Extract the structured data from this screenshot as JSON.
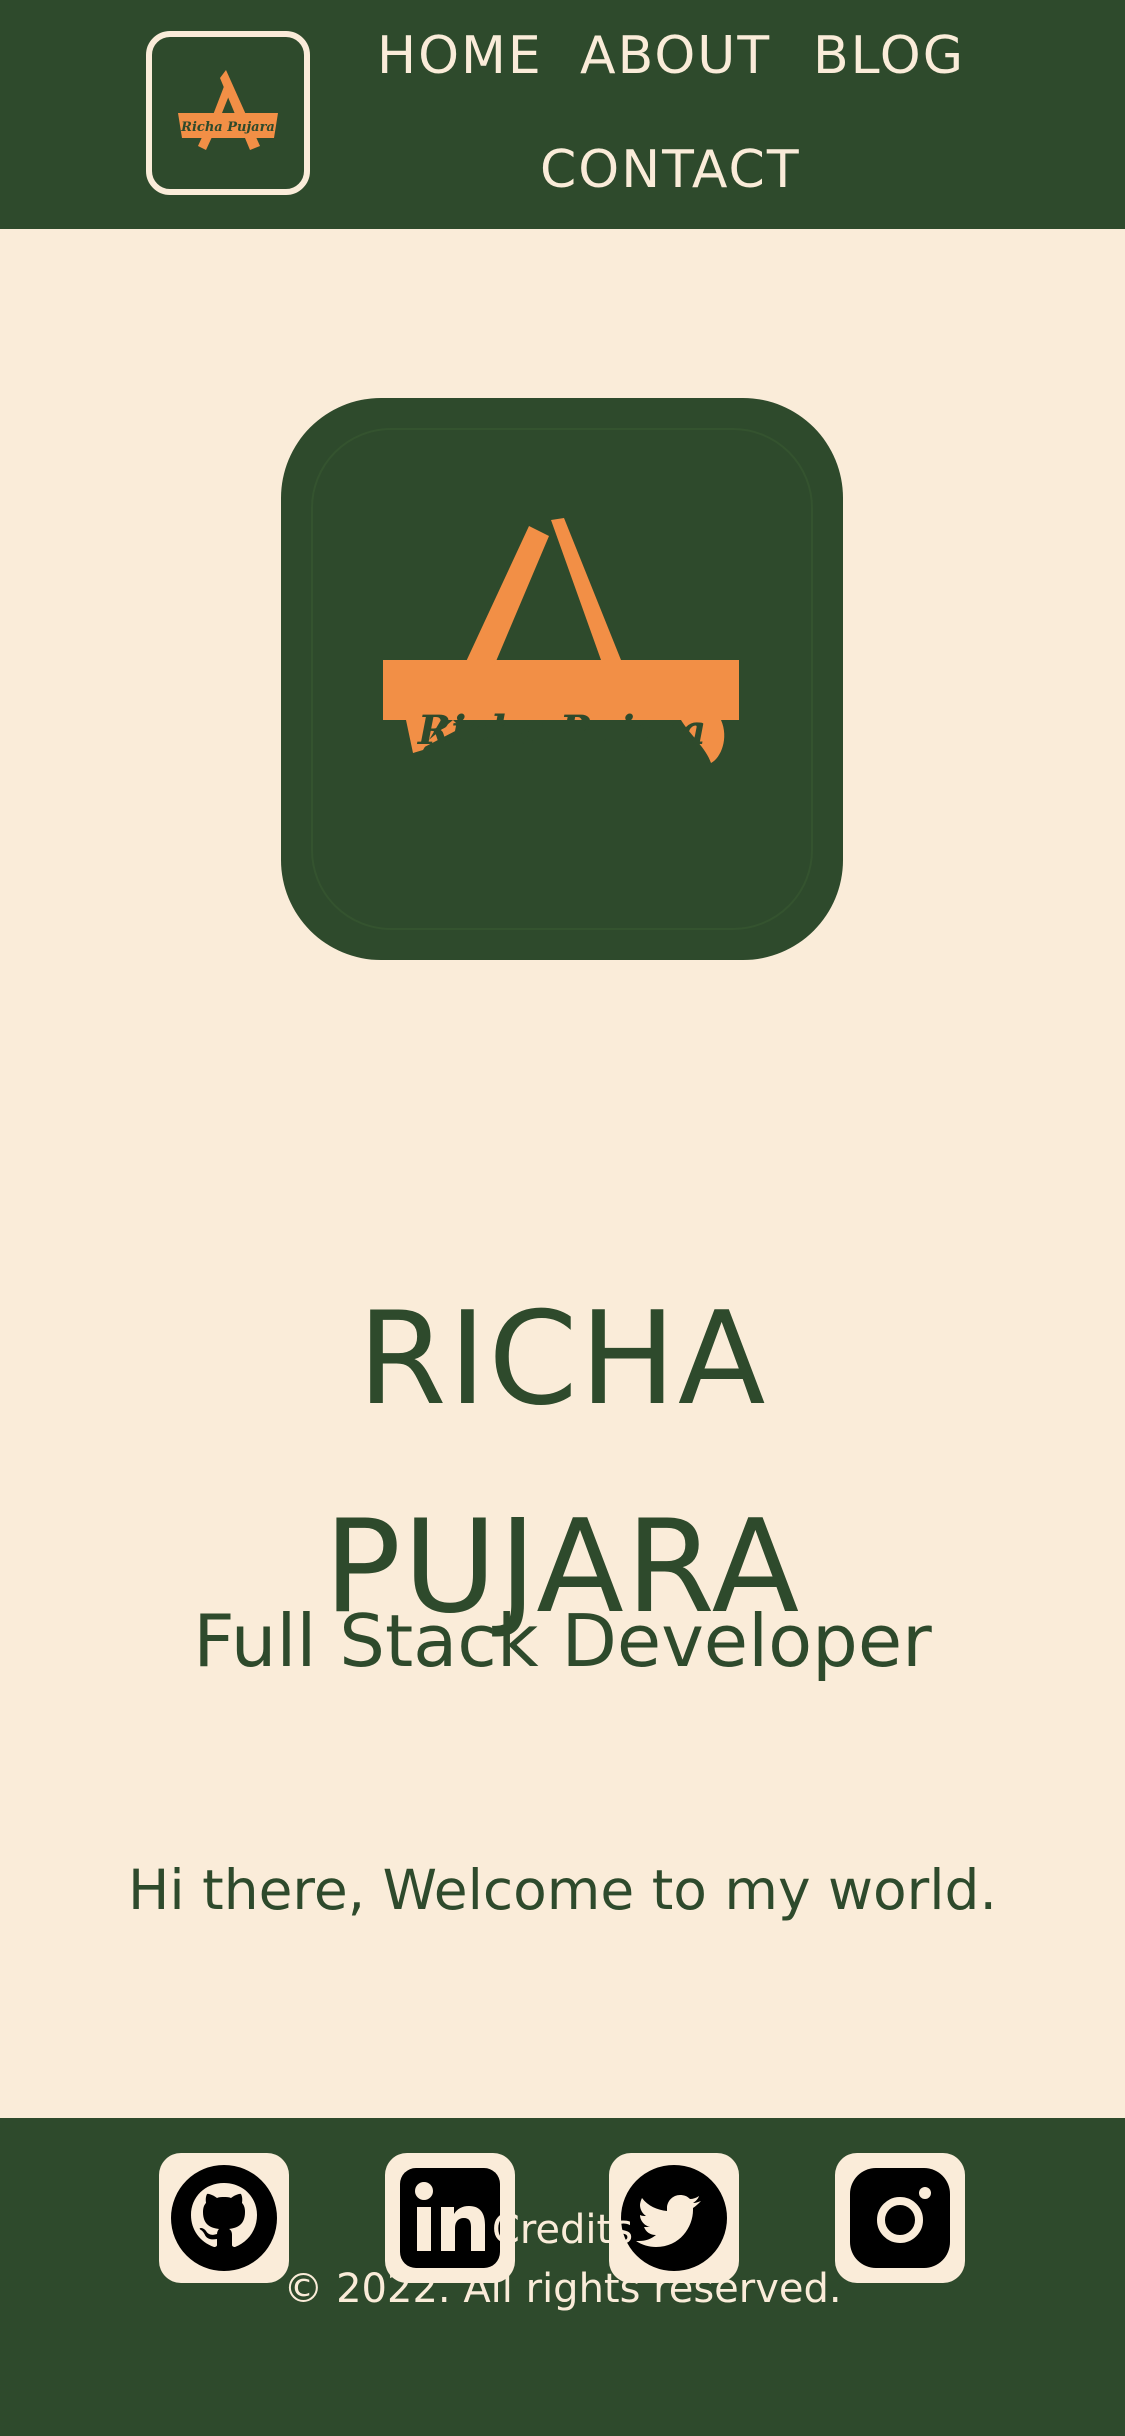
{
  "header": {
    "nav": {
      "home": "HOME",
      "about": "ABOUT",
      "blog": "BLOG",
      "contact": "CONTACT"
    },
    "logo_text": "Richa Pujara"
  },
  "hero": {
    "logo_text": "Richa Pujara",
    "name_line1": "RICHA",
    "name_line2": "PUJARA",
    "role": "Full Stack Developer",
    "welcome": "Hi there, Welcome to my world."
  },
  "footer": {
    "social": [
      {
        "icon": "github-icon"
      },
      {
        "icon": "linkedin-icon"
      },
      {
        "icon": "twitter-icon"
      },
      {
        "icon": "instagram-icon"
      }
    ],
    "credits": "Credits",
    "copyright": "© 2022. All rights reserved."
  },
  "colors": {
    "dark_green": "#2e4a2c",
    "cream": "#faecd9",
    "orange": "#f28f46"
  }
}
